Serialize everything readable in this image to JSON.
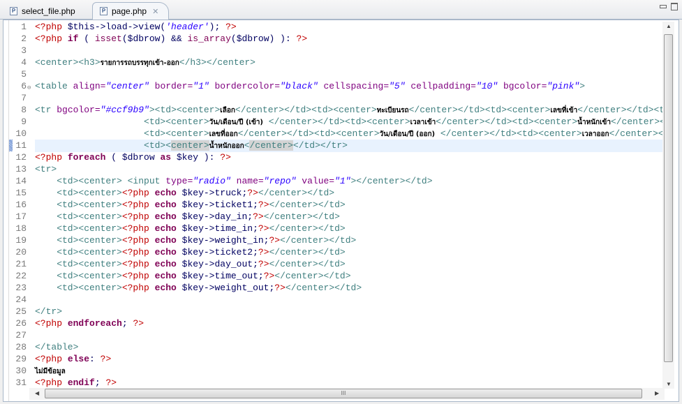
{
  "tabs": [
    {
      "label": "select_file.php",
      "icon": "P",
      "active": false
    },
    {
      "label": "page.php",
      "icon": "P",
      "active": true,
      "close": "✕"
    }
  ],
  "editor": {
    "current_line": 11,
    "lines": [
      {
        "n": "1",
        "tokens": [
          [
            "d",
            "<?php "
          ],
          [
            "p",
            "$this->load->view("
          ],
          [
            "s",
            "'header'"
          ],
          [
            "p",
            "); "
          ],
          [
            "d",
            "?>"
          ]
        ]
      },
      {
        "n": "2",
        "tokens": [
          [
            "d",
            "<?php "
          ],
          [
            "k",
            "if"
          ],
          [
            "p",
            " ( "
          ],
          [
            "f",
            "isset"
          ],
          [
            "p",
            "($dbrow) && "
          ],
          [
            "f",
            "is_array"
          ],
          [
            "p",
            "($dbrow) ): "
          ],
          [
            "d",
            "?>"
          ]
        ]
      },
      {
        "n": "3",
        "tokens": []
      },
      {
        "n": "4",
        "tokens": [
          [
            "t",
            "<center><h3>"
          ],
          [
            "x",
            "รายการรถบรรทุกเข้า-ออก"
          ],
          [
            "t",
            "</h3></center>"
          ]
        ]
      },
      {
        "n": "5",
        "tokens": []
      },
      {
        "n": "6",
        "fold": true,
        "tokens": [
          [
            "t",
            "<table "
          ],
          [
            "a",
            "align="
          ],
          [
            "s",
            "\"center\""
          ],
          [
            "a",
            " border="
          ],
          [
            "s",
            "\"1\""
          ],
          [
            "a",
            " bordercolor="
          ],
          [
            "s",
            "\"black\""
          ],
          [
            "a",
            " cellspacing="
          ],
          [
            "s",
            "\"5\""
          ],
          [
            "a",
            " cellpadding="
          ],
          [
            "s",
            "\"10\""
          ],
          [
            "a",
            " bgcolor="
          ],
          [
            "s",
            "\"pink\""
          ],
          [
            "t",
            ">"
          ]
        ]
      },
      {
        "n": "7",
        "tokens": []
      },
      {
        "n": "8",
        "tokens": [
          [
            "t",
            "<tr "
          ],
          [
            "a",
            "bgcolor="
          ],
          [
            "s",
            "\"#ccf9b9\""
          ],
          [
            "t",
            "><td><center>"
          ],
          [
            "x",
            "เลือก"
          ],
          [
            "t",
            "</center></td><td><center>"
          ],
          [
            "x",
            "ทะเบียนรถ"
          ],
          [
            "t",
            "</center></td><td><center>"
          ],
          [
            "x",
            "เลขที่เข้า"
          ],
          [
            "t",
            "</center></td><td><center>"
          ]
        ]
      },
      {
        "n": "9",
        "tokens": [
          [
            "t",
            "                    <td><center>"
          ],
          [
            "x",
            "วัน/เดือน/ปี (เข้า)"
          ],
          [
            "t",
            " </center></td><td><center>"
          ],
          [
            "x",
            "เวลาเข้า"
          ],
          [
            "t",
            "</center></td><td><center>"
          ],
          [
            "x",
            "น้ำหนักเข้า"
          ],
          [
            "t",
            "</center></td><td><center>"
          ]
        ]
      },
      {
        "n": "10",
        "tokens": [
          [
            "t",
            "                    <td><center>"
          ],
          [
            "x",
            "เลขที่ออก"
          ],
          [
            "t",
            "</center></td><td><center>"
          ],
          [
            "x",
            "วัน/เดือน/ปี (ออก)"
          ],
          [
            "t",
            " </center></td><td><center>"
          ],
          [
            "x",
            "เวลาออก"
          ],
          [
            "t",
            "</center></td>"
          ]
        ]
      },
      {
        "n": "11",
        "tokens": [
          [
            "t",
            "                    <td><"
          ],
          [
            "hl",
            "center>"
          ],
          [
            "x",
            "น้ำหนักออก"
          ],
          [
            "t",
            "<"
          ],
          [
            "hl",
            "/center>"
          ],
          [
            "t",
            "</td></tr>"
          ]
        ]
      },
      {
        "n": "12",
        "tokens": [
          [
            "d",
            "<?php "
          ],
          [
            "k",
            "foreach"
          ],
          [
            "p",
            " ( $dbrow "
          ],
          [
            "k",
            "as"
          ],
          [
            "p",
            " $key ): "
          ],
          [
            "d",
            "?>"
          ]
        ]
      },
      {
        "n": "13",
        "tokens": [
          [
            "t",
            "<tr>"
          ]
        ]
      },
      {
        "n": "14",
        "tokens": [
          [
            "t",
            "    <td><center> <input "
          ],
          [
            "a",
            "type="
          ],
          [
            "s",
            "\"radio\""
          ],
          [
            "a",
            " name="
          ],
          [
            "s",
            "\"repo\""
          ],
          [
            "a",
            " value="
          ],
          [
            "s",
            "\"1\""
          ],
          [
            "t",
            "></center></td>"
          ]
        ]
      },
      {
        "n": "15",
        "tokens": [
          [
            "t",
            "    <td><center>"
          ],
          [
            "d",
            "<?php "
          ],
          [
            "k",
            "echo"
          ],
          [
            "p",
            " $key->truck;"
          ],
          [
            "d",
            "?>"
          ],
          [
            "t",
            "</center></td>"
          ]
        ]
      },
      {
        "n": "16",
        "tokens": [
          [
            "t",
            "    <td><center>"
          ],
          [
            "d",
            "<?php "
          ],
          [
            "k",
            "echo"
          ],
          [
            "p",
            " $key->ticket1;"
          ],
          [
            "d",
            "?>"
          ],
          [
            "t",
            "</center></td>"
          ]
        ]
      },
      {
        "n": "17",
        "tokens": [
          [
            "t",
            "    <td><center>"
          ],
          [
            "d",
            "<?php "
          ],
          [
            "k",
            "echo"
          ],
          [
            "p",
            " $key->day_in;"
          ],
          [
            "d",
            "?>"
          ],
          [
            "t",
            "</center></td>"
          ]
        ]
      },
      {
        "n": "18",
        "tokens": [
          [
            "t",
            "    <td><center>"
          ],
          [
            "d",
            "<?php "
          ],
          [
            "k",
            "echo"
          ],
          [
            "p",
            " $key->time_in;"
          ],
          [
            "d",
            "?>"
          ],
          [
            "t",
            "</center></td>"
          ]
        ]
      },
      {
        "n": "19",
        "tokens": [
          [
            "t",
            "    <td><center>"
          ],
          [
            "d",
            "<?php "
          ],
          [
            "k",
            "echo"
          ],
          [
            "p",
            " $key->weight_in;"
          ],
          [
            "d",
            "?>"
          ],
          [
            "t",
            "</center></td>"
          ]
        ]
      },
      {
        "n": "20",
        "tokens": [
          [
            "t",
            "    <td><center>"
          ],
          [
            "d",
            "<?php "
          ],
          [
            "k",
            "echo"
          ],
          [
            "p",
            " $key->ticket2;"
          ],
          [
            "d",
            "?>"
          ],
          [
            "t",
            "</center></td>"
          ]
        ]
      },
      {
        "n": "21",
        "tokens": [
          [
            "t",
            "    <td><center>"
          ],
          [
            "d",
            "<?php "
          ],
          [
            "k",
            "echo"
          ],
          [
            "p",
            " $key->day_out;"
          ],
          [
            "d",
            "?>"
          ],
          [
            "t",
            "</center></td>"
          ]
        ]
      },
      {
        "n": "22",
        "tokens": [
          [
            "t",
            "    <td><center>"
          ],
          [
            "d",
            "<?php "
          ],
          [
            "k",
            "echo"
          ],
          [
            "p",
            " $key->time_out;"
          ],
          [
            "d",
            "?>"
          ],
          [
            "t",
            "</center></td>"
          ]
        ]
      },
      {
        "n": "23",
        "tokens": [
          [
            "t",
            "    <td><center>"
          ],
          [
            "d",
            "<?php "
          ],
          [
            "k",
            "echo"
          ],
          [
            "p",
            " $key->weight_out;"
          ],
          [
            "d",
            "?>"
          ],
          [
            "t",
            "</center></td>"
          ]
        ]
      },
      {
        "n": "24",
        "tokens": []
      },
      {
        "n": "25",
        "tokens": [
          [
            "t",
            "</tr>"
          ]
        ]
      },
      {
        "n": "26",
        "tokens": [
          [
            "d",
            "<?php "
          ],
          [
            "k",
            "endforeach"
          ],
          [
            "p",
            "; "
          ],
          [
            "d",
            "?>"
          ]
        ]
      },
      {
        "n": "27",
        "tokens": []
      },
      {
        "n": "28",
        "tokens": [
          [
            "t",
            "</table>"
          ]
        ]
      },
      {
        "n": "29",
        "tokens": [
          [
            "d",
            "<?php "
          ],
          [
            "k",
            "else"
          ],
          [
            "p",
            ": "
          ],
          [
            "d",
            "?>"
          ]
        ]
      },
      {
        "n": "30",
        "tokens": [
          [
            "x",
            "ไม่มีข้อมูล"
          ]
        ]
      },
      {
        "n": "31",
        "tokens": [
          [
            "d",
            "<?php "
          ],
          [
            "k",
            "endif"
          ],
          [
            "p",
            "; "
          ],
          [
            "d",
            "?>"
          ]
        ]
      }
    ]
  },
  "scrollbar": {
    "grip": "III"
  }
}
